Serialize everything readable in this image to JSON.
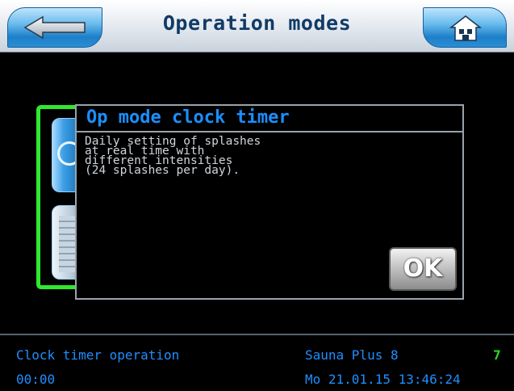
{
  "header": {
    "title": "Operation modes",
    "back_icon": "arrow-left-icon",
    "home_icon": "home-icon"
  },
  "dialog": {
    "title": "Op mode clock timer",
    "lines": [
      "Daily setting of splashes",
      "at real time with",
      "different intensities",
      "(24 splashes per day)."
    ],
    "ok_label": "OK"
  },
  "status": {
    "mode": "Clock timer operation",
    "time": "00:00",
    "device": "Sauna Plus 8",
    "count": "7",
    "datetime": "Mo 21.01.15 13:46:24"
  },
  "colors": {
    "accent_blue": "#1a8fff",
    "status_green": "#23e023",
    "frame_green": "#2fe82f",
    "header_text": "#113a66"
  }
}
